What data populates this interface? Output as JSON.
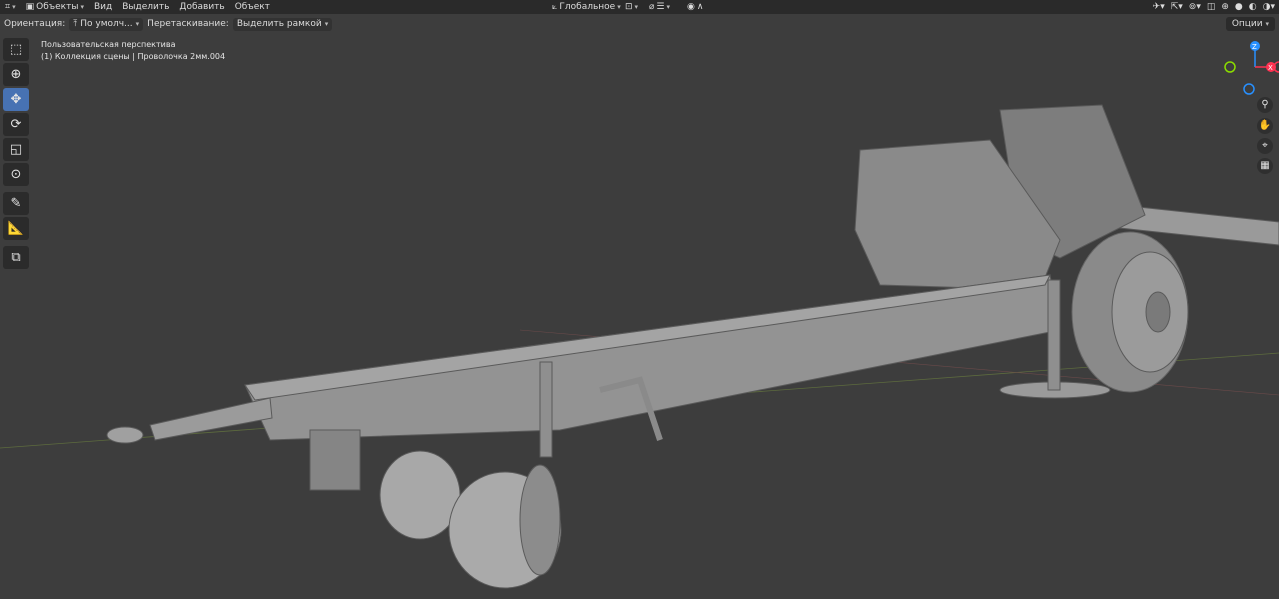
{
  "topbar": {
    "mode_label": "Объекты",
    "menu": [
      "Вид",
      "Выделить",
      "Добавить",
      "Объект"
    ],
    "transform_space": "Глобальное"
  },
  "header": {
    "orientation_label": "Ориентация:",
    "orientation_value": "По умолч...",
    "drag_label": "Перетаскивание:",
    "drag_value": "Выделить рамкой",
    "options_label": "Опции"
  },
  "viewport": {
    "view_name": "Пользовательская перспектива",
    "collection_info": "(1) Коллекция сцены | Проволочка 2мм.004"
  },
  "gizmo": {
    "z_label": "Z",
    "x_label": "X",
    "colors": {
      "x": "#ff3352",
      "y": "#8bdc00",
      "z": "#2890ff"
    }
  },
  "tools": [
    {
      "name": "select-box-tool",
      "icon": "cursor-box-icon"
    },
    {
      "name": "cursor-tool",
      "icon": "crosshair-icon"
    },
    {
      "name": "move-tool",
      "icon": "move-arrows-icon",
      "active": true
    },
    {
      "name": "rotate-tool",
      "icon": "rotate-icon"
    },
    {
      "name": "scale-tool",
      "icon": "scale-icon"
    },
    {
      "name": "transform-tool",
      "icon": "transform-icon"
    },
    {
      "name": "annotate-tool",
      "icon": "pencil-icon"
    },
    {
      "name": "measure-tool",
      "icon": "ruler-icon"
    },
    {
      "name": "add-cube-tool",
      "icon": "add-cube-icon"
    }
  ]
}
